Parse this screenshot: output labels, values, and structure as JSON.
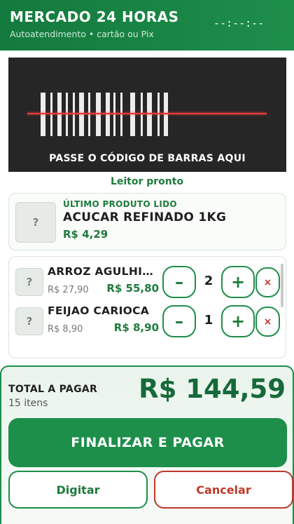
{
  "header": {
    "store_name": "MERCADO 24 HORAS",
    "subtitle": "Autoatendimento • cartão ou Pix",
    "clock": "--:--:--"
  },
  "scanner": {
    "instruction": "PASSE O CÓDIGO DE BARRAS AQUI",
    "status": "Leitor pronto",
    "laser_color": "#e23b3b"
  },
  "last_product": {
    "label": "ÚLTIMO PRODUTO LIDO",
    "thumb_placeholder": "?",
    "name": "ACUCAR REFINADO 1KG",
    "price": "R$ 4,29"
  },
  "cart": {
    "items": [
      {
        "thumb_placeholder": "?",
        "name": "ARROZ AGULHINHA",
        "unit_price": "R$ 27,90",
        "total": "R$ 55,80",
        "quantity": "2",
        "minus_label": "–",
        "plus_label": "+",
        "remove_label": "×"
      },
      {
        "thumb_placeholder": "?",
        "name": "FEIJAO CARIOCA",
        "unit_price": "R$ 8,90",
        "total": "R$ 8,90",
        "quantity": "1",
        "minus_label": "–",
        "plus_label": "+",
        "remove_label": "×"
      }
    ]
  },
  "footer": {
    "total_label": "TOTAL A PAGAR",
    "item_count": "15 itens",
    "total_value": "R$ 144,59",
    "pay_button": "FINALIZAR E PAGAR",
    "type_button": "Digitar",
    "cancel_button": "Cancelar"
  },
  "colors": {
    "brand_green": "#1e8e4b",
    "dark_green": "#16693a",
    "danger_red": "#c0392b"
  }
}
